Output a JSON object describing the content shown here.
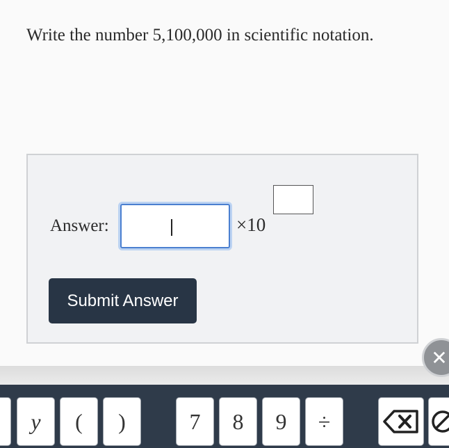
{
  "question": {
    "text": "Write the number 5,100,000 in scientific notation."
  },
  "answer": {
    "label": "Answer:",
    "value": "",
    "times_ten": "×10",
    "exponent_value": "",
    "submit_label": "Submit Answer"
  },
  "close_icon": {
    "glyph": "✕",
    "icon": "close-icon"
  },
  "keyboard": {
    "keys": [
      "y",
      "(",
      ")",
      "7",
      "8",
      "9",
      "÷"
    ],
    "backspace_icon": "backspace-icon",
    "clear_icon": "clear-icon"
  },
  "colors": {
    "submit_bg": "#283545",
    "keyboard_bg": "#2f3b4a",
    "input_focus": "#4a7fd0"
  }
}
